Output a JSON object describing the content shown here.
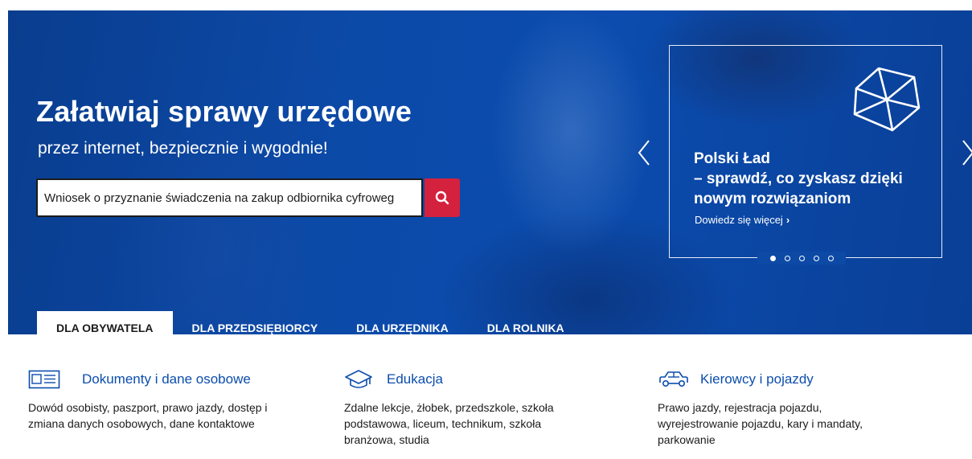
{
  "hero": {
    "title": "Załatwiaj sprawy urzędowe",
    "subtitle": "przez internet, bezpiecznie i wygodnie!",
    "background_color": "#0b4cae"
  },
  "search": {
    "value": "Wniosek o przyznanie świadczenia na zakup odbiornika cyfroweg",
    "button_icon": "search-icon",
    "button_color": "#d4213d"
  },
  "promo": {
    "title_line1": "Polski Ład",
    "title_line2": "– sprawdź, co zyskasz dzięki",
    "title_line3": "nowym rozwiązaniom",
    "link_label": "Dowiedz się więcej",
    "link_chevron": "›",
    "logo_icon": "polski-lad-logo-icon",
    "slides_total": 5,
    "active_slide": 1
  },
  "carousel": {
    "prev_icon": "chevron-left-icon",
    "next_icon": "chevron-right-icon"
  },
  "tabs": [
    {
      "label": "DLA OBYWATELA",
      "active": true
    },
    {
      "label": "DLA PRZEDSIĘBIORCY",
      "active": false
    },
    {
      "label": "DLA URZĘDNIKA",
      "active": false
    },
    {
      "label": "DLA ROLNIKA",
      "active": false
    }
  ],
  "categories": [
    {
      "icon": "id-card-icon",
      "title": "Dokumenty i dane osobowe",
      "desc_line1": "Dowód osobisty, paszport, prawo jazdy, dostęp i",
      "desc_line2": "zmiana danych osobowych, dane kontaktowe",
      "desc_line3": ""
    },
    {
      "icon": "graduation-cap-icon",
      "title": "Edukacja",
      "desc_line1": "Zdalne lekcje, żłobek, przedszkole, szkoła",
      "desc_line2": "podstawowa, liceum, technikum, szkoła",
      "desc_line3": "branżowa, studia"
    },
    {
      "icon": "car-icon",
      "title": "Kierowcy i pojazdy",
      "desc_line1": "Prawo jazdy, rejestracja pojazdu,",
      "desc_line2": "wyrejestrowanie pojazdu, kary i mandaty,",
      "desc_line3": "parkowanie"
    }
  ],
  "colors": {
    "accent_blue": "#0b4dad",
    "text": "#1b1b1b"
  }
}
